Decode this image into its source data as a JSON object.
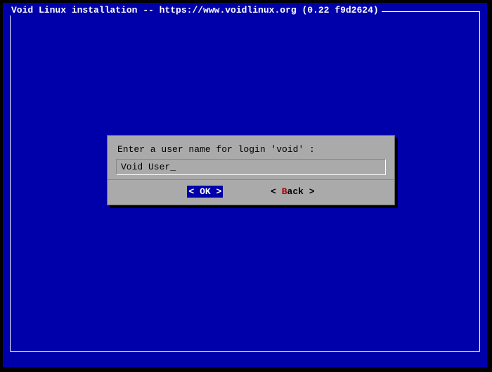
{
  "title": "Void Linux installation -- https://www.voidlinux.org (0.22 f9d2624)",
  "dialog": {
    "prompt": "Enter a user name for login 'void' :",
    "input_value": "Void User",
    "cursor": "_",
    "ok_left": "<",
    "ok_label": " OK ",
    "ok_right": ">",
    "back_left": "< ",
    "back_hotkey": "B",
    "back_rest": "ack",
    "back_right": " >"
  }
}
